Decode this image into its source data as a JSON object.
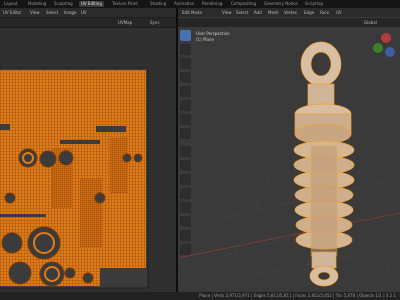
{
  "workspace_tabs": [
    "Layout",
    "Modeling",
    "Sculpting",
    "UV Editing",
    "Texture Paint",
    "Shading",
    "Animation",
    "Rendering",
    "Compositing",
    "Geometry Nodes",
    "Scripting"
  ],
  "active_tab": "UV Editing",
  "uv_editor": {
    "header_items": [
      "UV Editor",
      "View",
      "Select",
      "Image",
      "UV"
    ],
    "image_label": "UVMap",
    "sync_label": "Sync"
  },
  "viewport": {
    "mode": "Edit Mode",
    "menus": [
      "View",
      "Select",
      "Add",
      "Mesh",
      "Vertex",
      "Edge",
      "Face",
      "UV"
    ],
    "orientation": "Global",
    "overlay_title": "User Perspective",
    "overlay_object": "(1) Plane"
  },
  "status_bar": {
    "right_text": "Plane | Verts 2,971/2,971 | Edges 5,811/5,811 | Faces 2,852/2,852 | Tris 5,678 | Objects 1/1 | 3.2.1"
  },
  "colors": {
    "accent": "#4772b3",
    "uv_island": "#e07b1a",
    "mesh_wire": "#f0a030"
  }
}
